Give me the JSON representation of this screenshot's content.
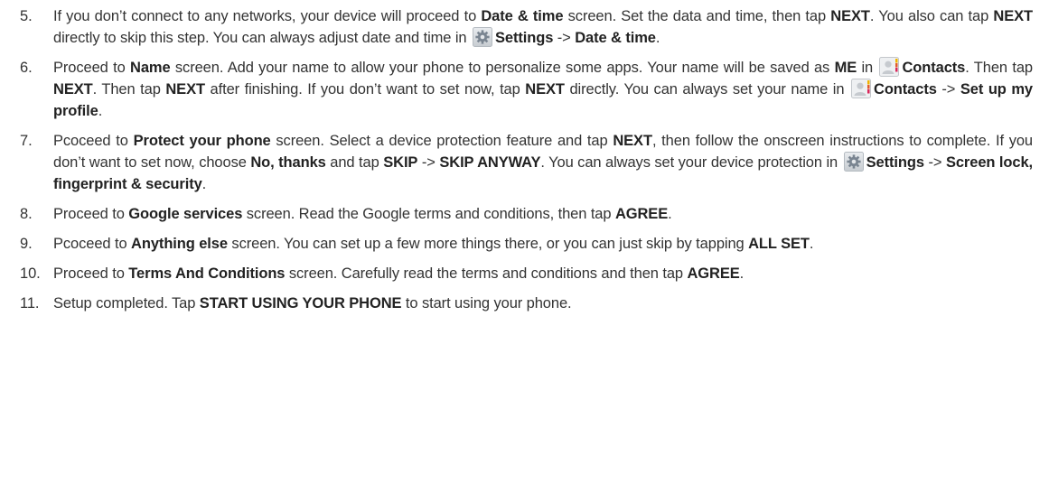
{
  "steps": [
    {
      "num": "5.",
      "t1": "If you don’t connect to any networks, your device will proceed to ",
      "b1": "Date & time",
      "t2": " screen. Set the data and time, then tap ",
      "b2": "NEXT",
      "t3": ". You also can tap ",
      "b3": "NEXT",
      "t4": " directly to skip this step. You can always adjust date and time in ",
      "icon1": "settings-gear-icon",
      "b4": "Settings",
      "t5": " -> ",
      "b5": "Date & time",
      "t6": "."
    },
    {
      "num": "6.",
      "t1": "Proceed to ",
      "b1": "Name",
      "t2": " screen. Add your name to allow your phone to personalize some apps. Your name will be saved as ",
      "b2": "ME",
      "t3": " in ",
      "icon1": "contacts-icon",
      "b3": "Contacts",
      "t4": ". Then tap ",
      "b4": "NEXT",
      "t5": ". Then tap ",
      "b5": "NEXT",
      "t6": " after finishing. If you don’t want to set now, tap ",
      "b6": "NEXT",
      "t7": " directly. You can always set your name in ",
      "icon2": "contacts-icon",
      "b7": "Contacts",
      "t8": " -> ",
      "b8": "Set up my profile",
      "t9": "."
    },
    {
      "num": "7.",
      "t1": "Pcoceed to ",
      "b1": "Protect your phone",
      "t2": " screen. Select a device protection feature and tap ",
      "b2": "NEXT",
      "t3": ", then follow the onscreen instructions to complete. If you don’t want to set now, choose ",
      "b3": "No, thanks",
      "t4": " and tap ",
      "b4": "SKIP",
      "t5": " -> ",
      "b5": "SKIP ANYWAY",
      "t6": ". You can always set your device protection in ",
      "icon1": "settings-gear-icon",
      "b6": "Settings",
      "t7": " -> ",
      "b7": "Screen lock, fingerprint & security",
      "t8": "."
    },
    {
      "num": "8.",
      "t1": "Proceed to ",
      "b1": "Google services",
      "t2": " screen. Read the Google terms and conditions, then tap ",
      "b2": "AGREE",
      "t3": "."
    },
    {
      "num": "9.",
      "t1": "Pcoceed to ",
      "b1": "Anything else",
      "t2": " screen. You can set up a few more things there, or you can just skip by tapping ",
      "b2": "ALL SET",
      "t3": "."
    },
    {
      "num": "10.",
      "t1": "Proceed to ",
      "b1": "Terms And Conditions",
      "t2": " screen. Carefully read the terms and conditions and then tap ",
      "b2": "AGREE",
      "t3": "."
    },
    {
      "num": "11.",
      "t1": "Setup completed. Tap ",
      "b1": "START USING YOUR PHONE",
      "t2": " to start using your phone."
    }
  ]
}
